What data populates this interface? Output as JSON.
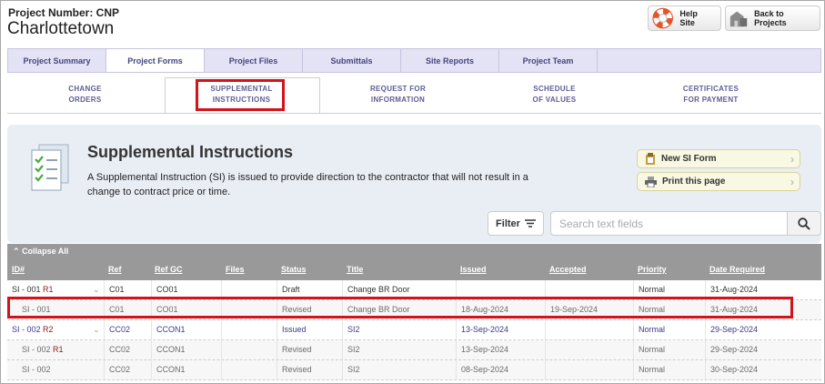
{
  "header": {
    "project_number": "Project Number: CNP",
    "project_name": "Charlottetown",
    "help_label": "Help Site",
    "back_label": "Back to Projects"
  },
  "tabs": [
    "Project Summary",
    "Project Forms",
    "Project Files",
    "Submittals",
    "Site Reports",
    "Project Team"
  ],
  "active_tab": "Project Forms",
  "subtabs": [
    {
      "l1": "CHANGE",
      "l2": "ORDERS"
    },
    {
      "l1": "SUPPLEMENTAL",
      "l2": "INSTRUCTIONS"
    },
    {
      "l1": "REQUEST FOR",
      "l2": "INFORMATION"
    },
    {
      "l1": "SCHEDULE",
      "l2": "OF VALUES"
    },
    {
      "l1": "CERTIFICATES",
      "l2": "FOR PAYMENT"
    }
  ],
  "active_subtab": "SUPPLEMENTAL INSTRUCTIONS",
  "banner": {
    "title": "Supplemental Instructions",
    "desc": "A Supplemental Instruction (SI) is issued to provide direction to the contractor that will not result in a change to contract price or time.",
    "new_btn": "New SI Form",
    "print_btn": "Print this page"
  },
  "filter": {
    "label": "Filter",
    "search_placeholder": "Search text fields"
  },
  "table": {
    "collapse_label": "Collapse All",
    "headers": [
      "ID#",
      "Ref",
      "Ref GC",
      "Files",
      "Status",
      "Title",
      "Issued",
      "Accepted",
      "Priority",
      "Date Required"
    ],
    "rows": [
      {
        "id": "SI - 001",
        "rev": "R1",
        "ref": "C01",
        "refgc": "CO01",
        "files": "",
        "status": "Draft",
        "title": "Change BR Door",
        "issued": "",
        "accepted": "",
        "priority": "Normal",
        "date_required": "31-Aug-2024",
        "child": false
      },
      {
        "id": "SI - 001",
        "rev": "",
        "ref": "C01",
        "refgc": "CO01",
        "files": "",
        "status": "Revised",
        "title": "Change BR Door",
        "issued": "18-Aug-2024",
        "accepted": "19-Sep-2024",
        "priority": "Normal",
        "date_required": "31-Aug-2024",
        "child": true
      },
      {
        "id": "SI - 002",
        "rev": "R2",
        "ref": "CC02",
        "refgc": "CCON1",
        "files": "",
        "status": "Issued",
        "title": "SI2",
        "issued": "13-Sep-2024",
        "accepted": "",
        "priority": "Normal",
        "date_required": "29-Sep-2024",
        "child": false
      },
      {
        "id": "SI - 002",
        "rev": "R1",
        "ref": "CC02",
        "refgc": "CCON1",
        "files": "",
        "status": "Revised",
        "title": "SI2",
        "issued": "13-Sep-2024",
        "accepted": "",
        "priority": "Normal",
        "date_required": "29-Sep-2024",
        "child": true
      },
      {
        "id": "SI - 002",
        "rev": "",
        "ref": "CC02",
        "refgc": "CCON1",
        "files": "",
        "status": "Revised",
        "title": "SI2",
        "issued": "08-Sep-2024",
        "accepted": "",
        "priority": "Normal",
        "date_required": "30-Sep-2024",
        "child": true
      }
    ]
  }
}
